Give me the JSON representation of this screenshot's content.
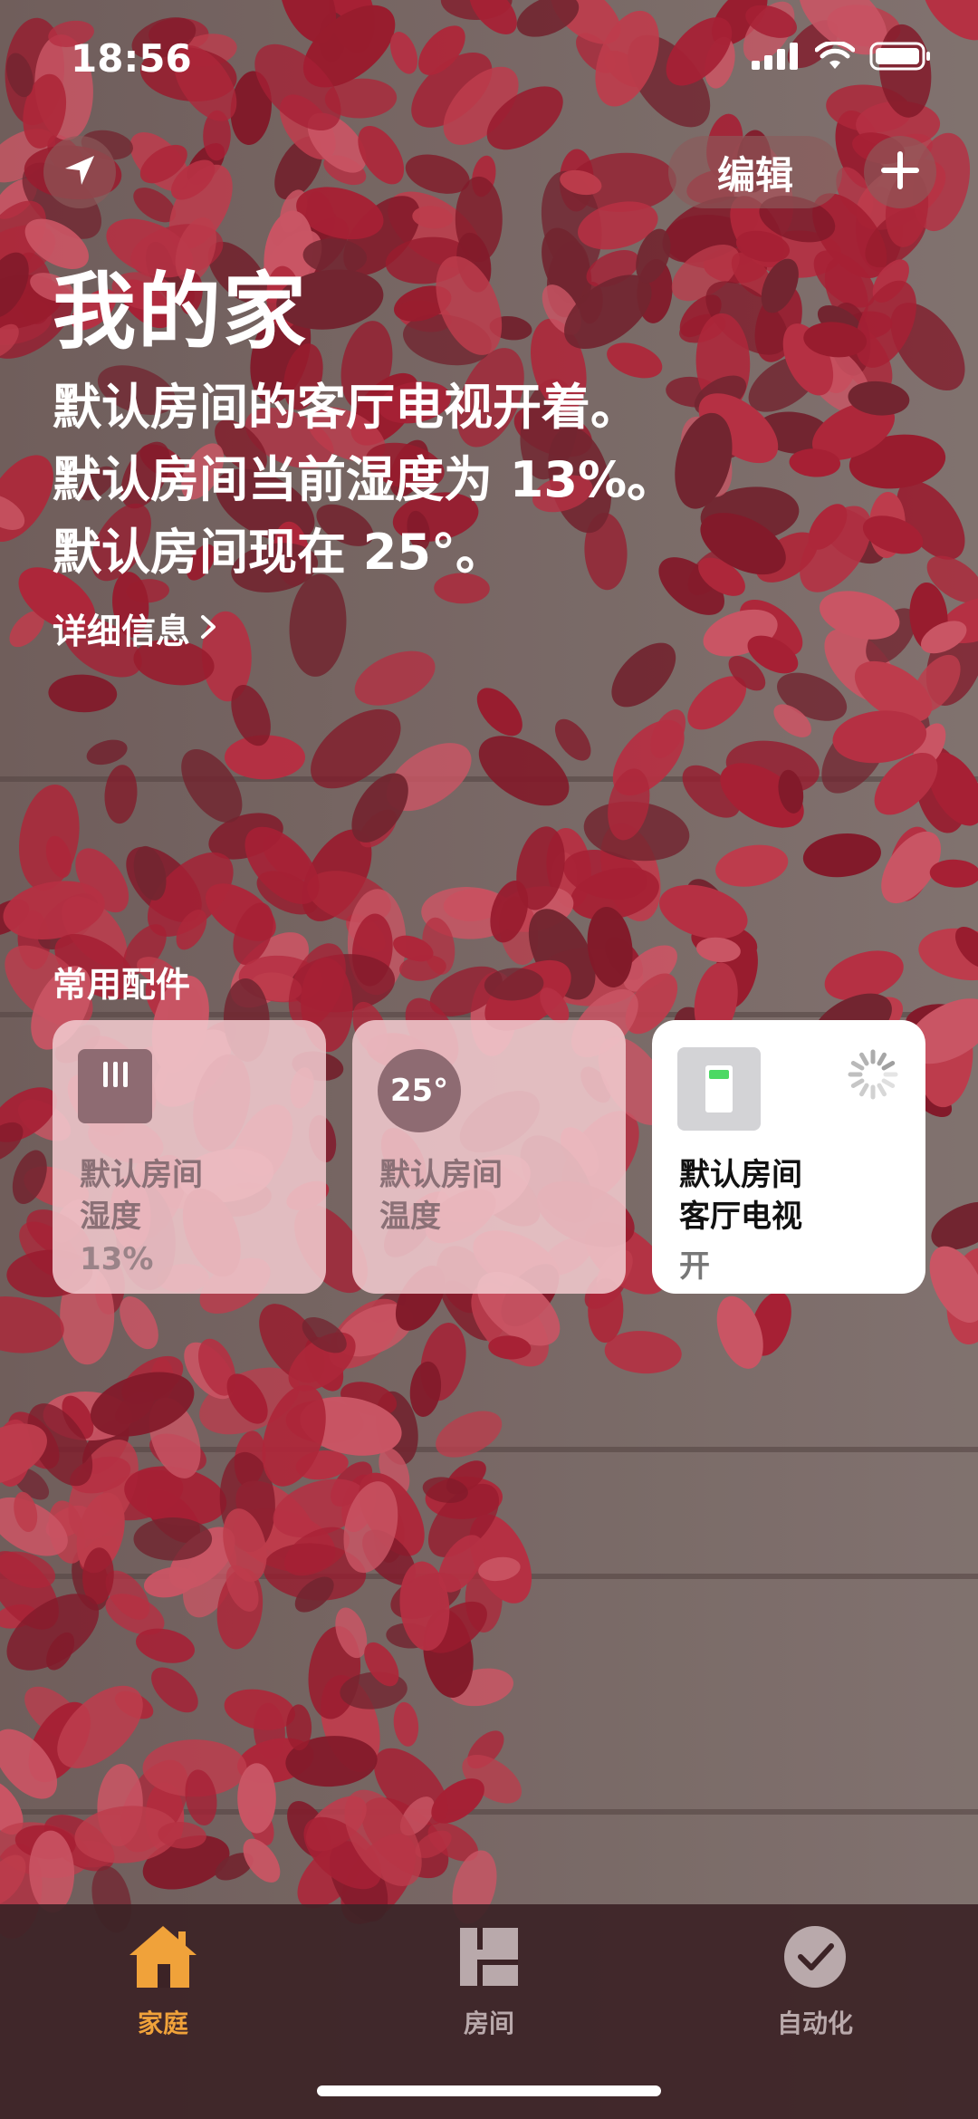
{
  "status_bar": {
    "time": "18:56"
  },
  "header": {
    "edit_label": "编辑",
    "title": "我的家",
    "summary": [
      "默认房间的客厅电视开着。",
      "默认房间当前湿度为 13%。",
      "默认房间现在 25°。"
    ],
    "details_label": "详细信息"
  },
  "favorites": {
    "section_label": "常用配件",
    "tiles": [
      {
        "room": "默认房间",
        "name": "湿度",
        "state": "13%",
        "icon": "humidity-sensor-icon"
      },
      {
        "room": "默认房间",
        "name": "温度",
        "icon_text": "25°",
        "icon": "temperature-sensor-icon"
      },
      {
        "room": "默认房间",
        "name": "客厅电视",
        "state": "开",
        "icon": "switch-icon"
      }
    ]
  },
  "tabbar": {
    "tabs": [
      {
        "label": "家庭",
        "icon": "house-icon",
        "active": true
      },
      {
        "label": "房间",
        "icon": "rooms-icon",
        "active": false
      },
      {
        "label": "自动化",
        "icon": "clock-check-icon",
        "active": false
      }
    ]
  },
  "colors": {
    "accent": "#f0a23a",
    "inactive_tab": "#b9a9ab",
    "tile_on": "#ffffff",
    "tile_off": "#f0c8cd"
  }
}
